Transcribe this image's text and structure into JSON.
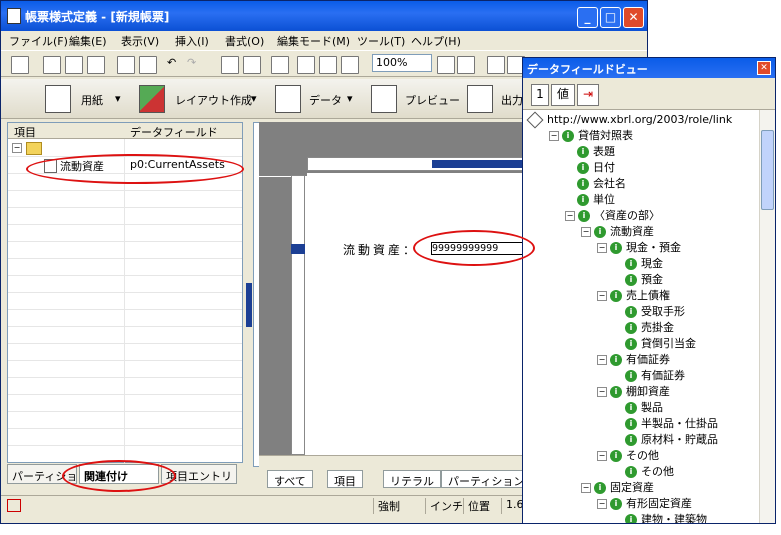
{
  "main_window": {
    "title": "帳票様式定義 - [新規帳票]",
    "controls": {
      "min": "_",
      "max": "□",
      "close": "✕"
    }
  },
  "menu": [
    "ファイル(F)",
    "編集(E)",
    "表示(V)",
    "挿入(I)",
    "書式(O)",
    "編集モード(M)",
    "ツール(T)",
    "ヘルプ(H)"
  ],
  "zoom": "100%",
  "toolbar2": {
    "paper": "用紙",
    "layout": "レイアウト作成",
    "data": "データ",
    "preview": "プレビュー",
    "output": "出力"
  },
  "left_panel": {
    "col_item": "項目",
    "col_field": "データフィールド",
    "row_item": "流動資産",
    "row_field": "p0:CurrentAssets",
    "tabs": [
      "パーティション",
      "関連付け",
      "項目エントリ"
    ]
  },
  "design": {
    "field_label": "流動資産：",
    "field_value": "99999999999"
  },
  "bottom_tabs": [
    "すべて",
    "項目",
    "リテラル",
    "パーティション罫線"
  ],
  "status": {
    "mode": "強制",
    "unit": "インチ",
    "pos_label": "位置",
    "pos_value": "1.6"
  },
  "dfv": {
    "title": "データフィールドビュー",
    "btn1": "1",
    "btn2": "値",
    "root": "http://www.xbrl.org/2003/role/link",
    "tree": [
      {
        "label": "貸借対照表",
        "level": 1,
        "exp": "−"
      },
      {
        "label": "表題",
        "level": 2
      },
      {
        "label": "日付",
        "level": 2
      },
      {
        "label": "会社名",
        "level": 2
      },
      {
        "label": "単位",
        "level": 2
      },
      {
        "label": "〈資産の部〉",
        "level": 2,
        "exp": "−"
      },
      {
        "label": "流動資産",
        "level": 3,
        "exp": "−"
      },
      {
        "label": "現金・預金",
        "level": 4,
        "exp": "−"
      },
      {
        "label": "現金",
        "level": 5
      },
      {
        "label": "預金",
        "level": 5
      },
      {
        "label": "売上債権",
        "level": 4,
        "exp": "−"
      },
      {
        "label": "受取手形",
        "level": 5
      },
      {
        "label": "売掛金",
        "level": 5
      },
      {
        "label": "貸倒引当金",
        "level": 5
      },
      {
        "label": "有価証券",
        "level": 4,
        "exp": "−"
      },
      {
        "label": "有価証券",
        "level": 5
      },
      {
        "label": "棚卸資産",
        "level": 4,
        "exp": "−"
      },
      {
        "label": "製品",
        "level": 5
      },
      {
        "label": "半製品・仕掛品",
        "level": 5
      },
      {
        "label": "原材料・貯蔵品",
        "level": 5
      },
      {
        "label": "その他",
        "level": 4,
        "exp": "−"
      },
      {
        "label": "その他",
        "level": 5
      },
      {
        "label": "固定資産",
        "level": 3,
        "exp": "−"
      },
      {
        "label": "有形固定資産",
        "level": 4,
        "exp": "−"
      },
      {
        "label": "建物・建築物",
        "level": 5
      }
    ]
  }
}
